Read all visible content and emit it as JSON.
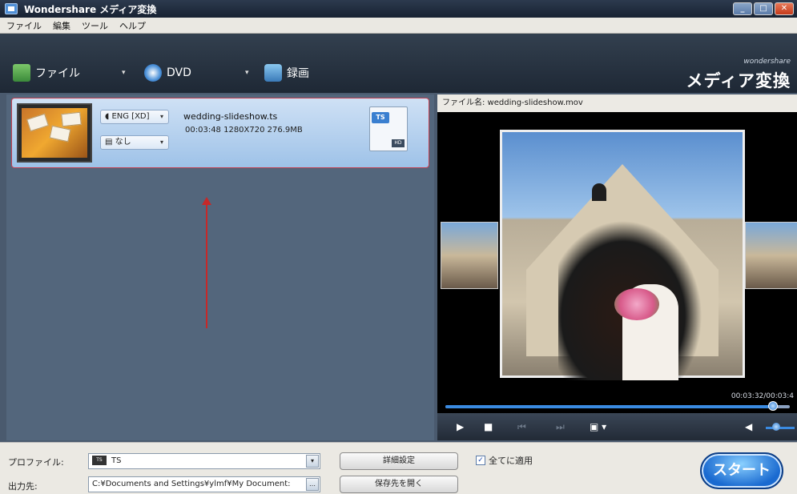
{
  "window": {
    "title": "Wondershare メディア変換"
  },
  "menu": [
    "ファイル",
    "編集",
    "ツール",
    "ヘルプ"
  ],
  "toolbar": {
    "file_label": "ファイル",
    "dvd_label": "DVD",
    "record_label": "録画",
    "brand_small": "wondershare",
    "brand_large": "メディア変換"
  },
  "file_item": {
    "audio_track": "ENG [XD]",
    "subtitle": "なし",
    "filename": "wedding-slideshow.ts",
    "info": "00:03:48  1280X720  276.9MB",
    "format_badge": "TS",
    "format_sub": "HD"
  },
  "preview": {
    "filename_label": "ファイル名: wedding-slideshow.mov",
    "timecode": "00:03:32/00:03:4",
    "progress": 0.95
  },
  "bottom": {
    "profile_label": "プロファイル:",
    "profile_value": "TS",
    "output_label": "出力先:",
    "output_path": "C:¥Documents and Settings¥ylmf¥My Document:",
    "advanced_button": "詳細設定",
    "open_folder_button": "保存先を開く",
    "apply_all_label": "全てに適用",
    "apply_all_checked": true,
    "start_button": "スタート"
  },
  "colors": {
    "accent": "#3a8ae0",
    "selection_border": "#c04050",
    "arrow": "#c62828"
  }
}
